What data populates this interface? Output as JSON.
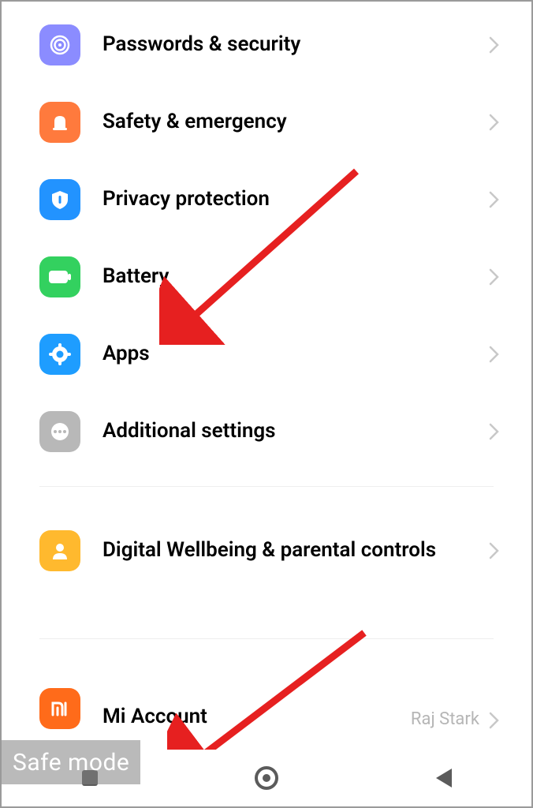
{
  "settings": {
    "items": [
      {
        "label": "Passwords & security",
        "icon": "fingerprint-icon",
        "bg": "#8b8cff",
        "fg": "#ffffff"
      },
      {
        "label": "Safety & emergency",
        "icon": "siren-icon",
        "bg": "#ff7a3d",
        "fg": "#ffffff"
      },
      {
        "label": "Privacy protection",
        "icon": "shield-icon",
        "bg": "#2293ff",
        "fg": "#ffffff"
      },
      {
        "label": "Battery",
        "icon": "battery-icon",
        "bg": "#33d15f",
        "fg": "#ffffff"
      },
      {
        "label": "Apps",
        "icon": "gear-icon",
        "bg": "#1e9dff",
        "fg": "#ffffff"
      },
      {
        "label": "Additional settings",
        "icon": "dots-icon",
        "bg": "#b8b8b8",
        "fg": "#ffffff"
      }
    ],
    "wellbeing": {
      "label": "Digital Wellbeing & parental controls",
      "icon": "person-icon",
      "bg": "#ffb92e",
      "fg": "#ffffff"
    },
    "account": {
      "label": "Mi Account",
      "value": "Raj Stark",
      "icon": "mi-icon",
      "bg": "#ff6b1a",
      "fg": "#ffffff"
    }
  },
  "overlay": {
    "safe_mode_label": "Safe mode"
  },
  "colors": {
    "chevron": "#c8c8c8",
    "nav": "#5b5b5b",
    "arrow": "#e62020"
  }
}
